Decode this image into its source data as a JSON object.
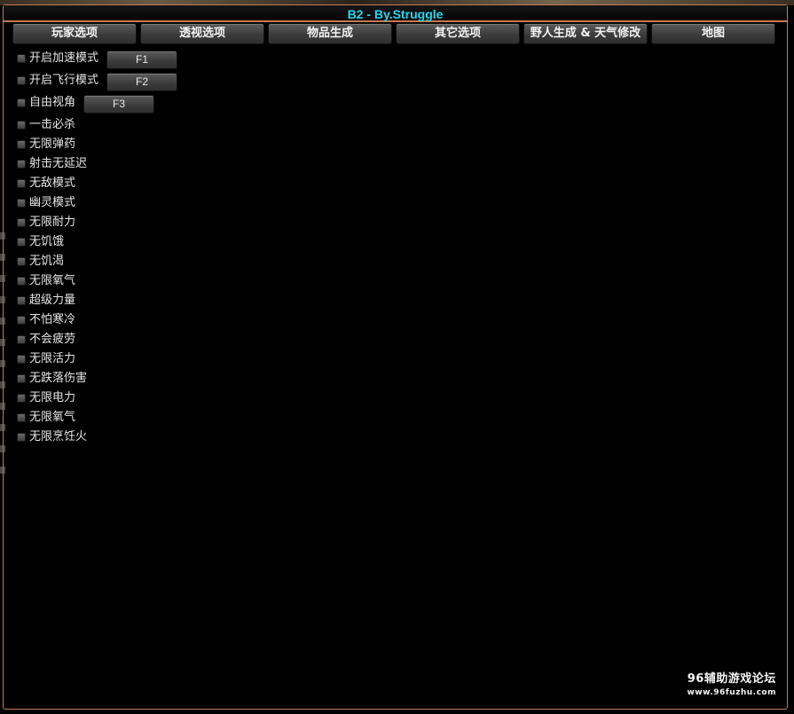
{
  "window": {
    "title": "B2 - By.Struggle"
  },
  "tabs": [
    {
      "label": "玩家选项"
    },
    {
      "label": "透视选项"
    },
    {
      "label": "物品生成"
    },
    {
      "label": "其它选项"
    },
    {
      "label": "野人生成 & 天气修改"
    },
    {
      "label": "地图"
    }
  ],
  "options": [
    {
      "label": "开启加速模式",
      "hotkey": "F1"
    },
    {
      "label": "开启飞行模式",
      "hotkey": "F2"
    },
    {
      "label": "自由视角",
      "hotkey": "F3"
    },
    {
      "label": "一击必杀"
    },
    {
      "label": "无限弹药"
    },
    {
      "label": "射击无延迟"
    },
    {
      "label": "无敌模式"
    },
    {
      "label": "幽灵模式"
    },
    {
      "label": "无限耐力"
    },
    {
      "label": "无饥饿"
    },
    {
      "label": "无饥渴"
    },
    {
      "label": "无限氧气"
    },
    {
      "label": "超级力量"
    },
    {
      "label": "不怕寒冷"
    },
    {
      "label": "不会疲劳"
    },
    {
      "label": "无限活力"
    },
    {
      "label": "无跌落伤害"
    },
    {
      "label": "无限电力"
    },
    {
      "label": "无限氧气"
    },
    {
      "label": "无限烹饪火"
    }
  ],
  "watermark": {
    "main": "96辅助游戏论坛",
    "sub": "www.96fuzhu.com"
  },
  "colors": {
    "accent_border": "#c77a55",
    "title_text": "#22d8f0"
  }
}
